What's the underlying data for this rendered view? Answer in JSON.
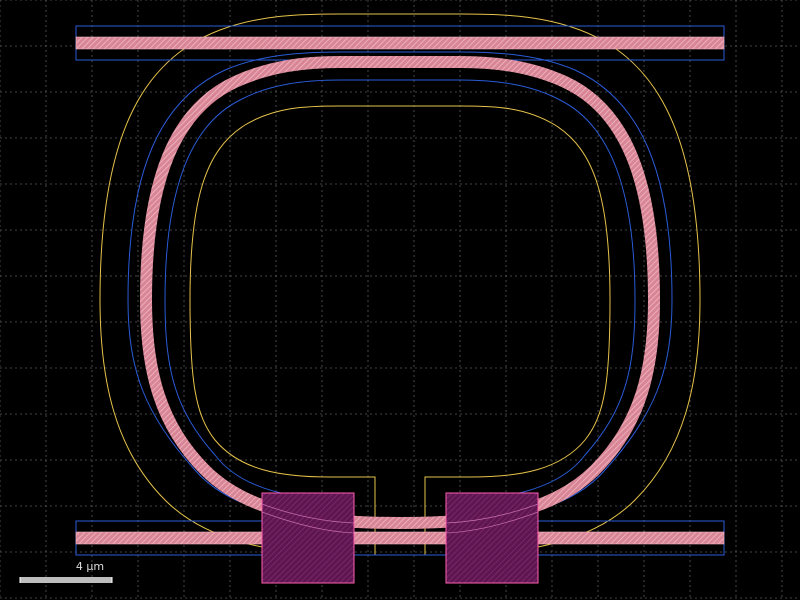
{
  "scalebar": {
    "label": "4 µm"
  },
  "colors": {
    "background": "#000000",
    "grid": "#5a5a5a",
    "waveguide": "#e89aaa",
    "cladding": "#2a5bd7",
    "slab": "#e6c34a",
    "pad_fill": "#6a1a5a",
    "pad_edge": "#ff5fb0"
  }
}
